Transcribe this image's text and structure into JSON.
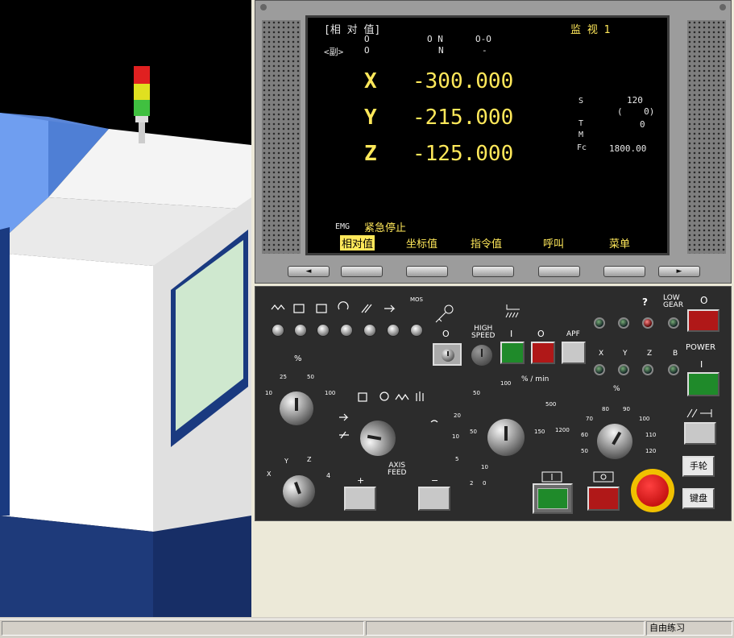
{
  "display": {
    "mode_title": "[相 对 值]",
    "monitor_title": "监 视 1",
    "sub_label": "<副>",
    "row1": {
      "a": "O",
      "b": "O N",
      "c": "O-O"
    },
    "row2": {
      "a": "O",
      "b": "N",
      "c": "-"
    },
    "axes": [
      {
        "axis": "X",
        "value": "-300.000"
      },
      {
        "axis": "Y",
        "value": "-215.000"
      },
      {
        "axis": "Z",
        "value": "-125.000"
      }
    ],
    "info": {
      "s_label": "S",
      "s_value": "120",
      "paren_value": "(    0)",
      "t_label": "T",
      "t_value": "0",
      "m_label": "M",
      "fc_label": "Fc",
      "fc_value": "1800.00"
    },
    "emg_label": "EMG",
    "emg_text": "紧急停止",
    "softkeys": [
      "相对值",
      "坐标值",
      "指令值",
      "呼叫",
      "菜单"
    ]
  },
  "bezel_keys": [
    "◄",
    "",
    "",
    "",
    "",
    "",
    "►"
  ],
  "panel": {
    "mos_label": "MOS",
    "q_label": "?",
    "low_gear_label": "LOW\nGEAR",
    "o_label": "O",
    "high_speed_label": "HIGH\nSPEED",
    "i_label": "I",
    "o2_label": "O",
    "apf_label": "APF",
    "power_label": "POWER",
    "power_i": "I",
    "x": "X",
    "y": "Y",
    "z": "Z",
    "b": "B",
    "pct_label": "%",
    "feed_ticks": [
      "10",
      "25",
      "50",
      "100"
    ],
    "spindle_unit": "% / min",
    "spindle_ticks": [
      "0",
      "2",
      "5",
      "10",
      "20",
      "50",
      "100",
      "500",
      "1200",
      "150",
      "50",
      "10"
    ],
    "rapid_ticks": [
      "50",
      "60",
      "70",
      "80",
      "90",
      "100",
      "110",
      "120"
    ],
    "axis_sel_ticks": [
      "X",
      "Y",
      "Z",
      "4"
    ],
    "axis_feed_label": "AXIS\nFEED",
    "plus": "+",
    "minus": "−",
    "handwheel_button": "手轮",
    "keyboard_button": "键盘"
  },
  "status": {
    "left": "",
    "middle": "",
    "right": "自由练习"
  }
}
